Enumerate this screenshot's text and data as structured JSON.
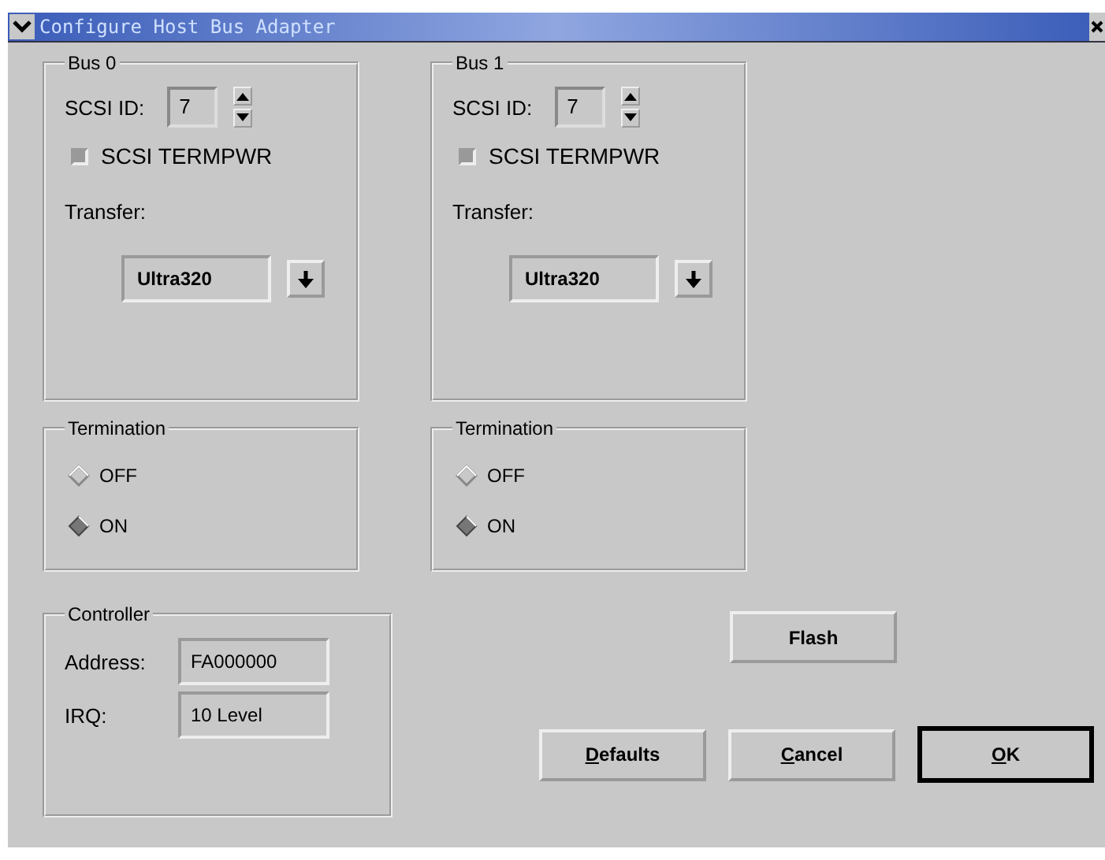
{
  "window": {
    "title": "Configure Host Bus Adapter"
  },
  "buses": [
    {
      "title": "Bus 0",
      "scsi_id_label": "SCSI ID:",
      "scsi_id": "7",
      "termpwr": {
        "label": "SCSI TERMPWR",
        "checked": false
      },
      "transfer_label": "Transfer:",
      "transfer": "Ultra320"
    },
    {
      "title": "Bus 1",
      "scsi_id_label": "SCSI ID:",
      "scsi_id": "7",
      "termpwr": {
        "label": "SCSI TERMPWR",
        "checked": false
      },
      "transfer_label": "Transfer:",
      "transfer": "Ultra320"
    }
  ],
  "terminations": [
    {
      "title": "Termination",
      "options": [
        {
          "label": "OFF",
          "selected": false
        },
        {
          "label": "ON",
          "selected": true
        }
      ]
    },
    {
      "title": "Termination",
      "options": [
        {
          "label": "OFF",
          "selected": false
        },
        {
          "label": "ON",
          "selected": true
        }
      ]
    }
  ],
  "controller": {
    "title": "Controller",
    "fields": [
      {
        "label": "Address:",
        "value": "FA000000"
      },
      {
        "label": "IRQ:",
        "value": "10 Level"
      }
    ]
  },
  "buttons": [
    {
      "label": "Flash",
      "mnemonic": false,
      "default": false
    },
    {
      "label": "Defaults",
      "mnemonic": true,
      "default": false
    },
    {
      "label": "Cancel",
      "mnemonic": true,
      "default": false
    },
    {
      "label": "OK",
      "mnemonic": true,
      "default": true
    }
  ]
}
